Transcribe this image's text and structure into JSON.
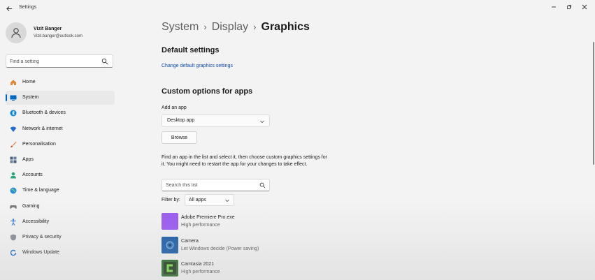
{
  "window": {
    "title": "Settings",
    "controls": [
      "minimize",
      "restore",
      "close"
    ]
  },
  "profile": {
    "name": "Vizit Banger",
    "email": "Vizit.banger@outlook.com"
  },
  "search": {
    "placeholder": "Find a setting"
  },
  "sidebar": {
    "active": "System",
    "items": [
      {
        "label": "Home",
        "icon": "home-icon",
        "color": "#e0883a"
      },
      {
        "label": "System",
        "icon": "system-icon",
        "color": "#0067c0"
      },
      {
        "label": "Bluetooth & devices",
        "icon": "bluetooth-icon",
        "color": "#0a84d8"
      },
      {
        "label": "Network & internet",
        "icon": "wifi-icon",
        "color": "#1f6fd1"
      },
      {
        "label": "Personalisation",
        "icon": "brush-icon",
        "color": "#e07a3a"
      },
      {
        "label": "Apps",
        "icon": "apps-icon",
        "color": "#4b5f7a"
      },
      {
        "label": "Accounts",
        "icon": "account-icon",
        "color": "#2aa37a"
      },
      {
        "label": "Time & language",
        "icon": "globe-icon",
        "color": "#2a8fd6"
      },
      {
        "label": "Gaming",
        "icon": "gamepad-icon",
        "color": "#7a7a7a"
      },
      {
        "label": "Accessibility",
        "icon": "accessibility-icon",
        "color": "#1e70c9"
      },
      {
        "label": "Privacy & security",
        "icon": "shield-icon",
        "color": "#8a8f98"
      },
      {
        "label": "Windows Update",
        "icon": "update-icon",
        "color": "#1670d0"
      }
    ]
  },
  "breadcrumb": {
    "items": [
      "System",
      "Display",
      "Graphics"
    ]
  },
  "main": {
    "default_settings": {
      "heading": "Default settings",
      "link": "Change default graphics settings"
    },
    "custom_options": {
      "heading": "Custom options for apps",
      "add_app_label": "Add an app",
      "app_type_selected": "Desktop app",
      "browse_label": "Browse",
      "description": "Find an app in the list and select it, then choose custom graphics settings for it. You might need to restart the app for your changes to take effect.",
      "search_placeholder": "Search this list",
      "filter_label": "Filter by:",
      "filter_selected": "All apps"
    },
    "apps": [
      {
        "name": "Adobe Premiere Pro.exe",
        "preference": "High performance",
        "icon": "premiere-icon",
        "color": "#9b5cf0"
      },
      {
        "name": "Camera",
        "preference": "Let Windows decide (Power saving)",
        "icon": "camera-icon",
        "color": "#1f5fa8"
      },
      {
        "name": "Camtasia 2021",
        "preference": "High performance",
        "icon": "camtasia-icon",
        "color": "#2c6a2e"
      }
    ]
  }
}
